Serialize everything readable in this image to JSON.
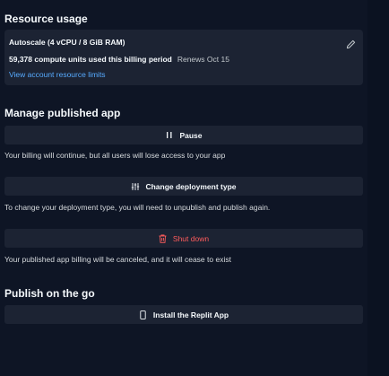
{
  "resource_usage": {
    "title": "Resource usage",
    "plan": "Autoscale (4 vCPU / 8 GiB RAM)",
    "compute_units": "59,378 compute units used this billing period",
    "renews": "Renews Oct 15",
    "limits_link": "View account resource limits",
    "edit_icon": "pencil-icon"
  },
  "manage": {
    "title": "Manage published app",
    "pause_label": "Pause",
    "pause_desc": "Your billing will continue, but all users will lose access to your app",
    "change_type_label": "Change deployment type",
    "change_type_desc": "To change your deployment type, you will need to unpublish and publish again.",
    "shutdown_label": "Shut down",
    "shutdown_desc": "Your published app billing will be canceled, and it will cease to exist"
  },
  "publish_on_go": {
    "title": "Publish on the go",
    "install_label": "Install the Replit App"
  },
  "colors": {
    "background": "#0e1525",
    "card": "#1c2333",
    "link": "#57abff",
    "danger": "#ff5c5c"
  }
}
